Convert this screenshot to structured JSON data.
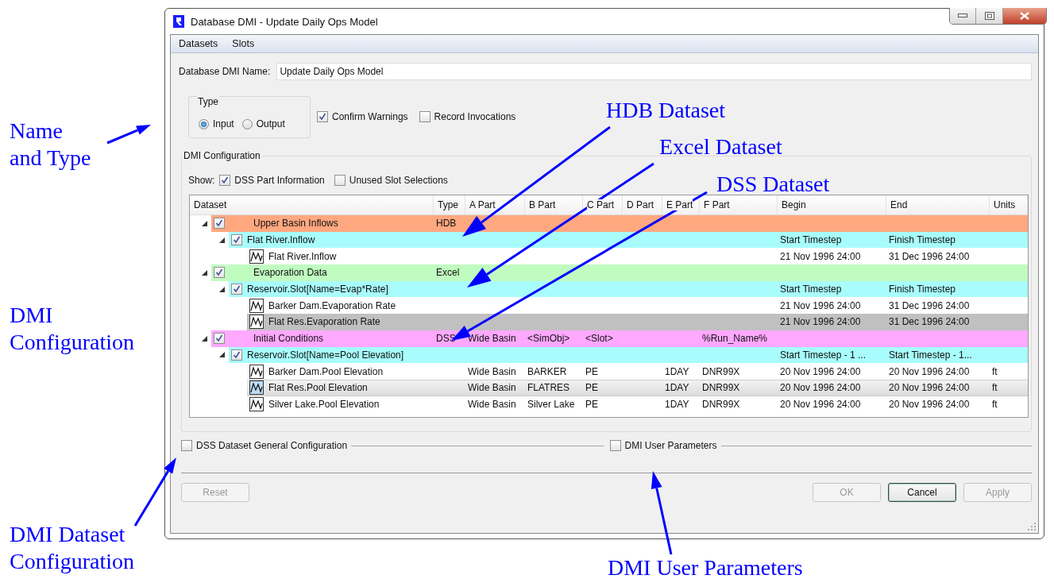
{
  "window": {
    "title": "Database DMI - Update Daily Ops Model"
  },
  "menu": [
    {
      "label": "Datasets"
    },
    {
      "label": "Slots"
    }
  ],
  "name_field": {
    "label": "Database DMI Name:",
    "value": "Update Daily Ops Model"
  },
  "type_group": {
    "title": "Type",
    "options": [
      {
        "label": "Input",
        "selected": true
      },
      {
        "label": "Output",
        "selected": false
      }
    ]
  },
  "options": [
    {
      "label": "Confirm Warnings",
      "checked": true
    },
    {
      "label": "Record Invocations",
      "checked": false
    }
  ],
  "dmi_configuration": {
    "title": "DMI Configuration",
    "show_label": "Show:",
    "show_options": [
      {
        "label": "DSS Part Information",
        "checked": true
      },
      {
        "label": "Unused Slot Selections",
        "checked": false
      }
    ],
    "columns": [
      "Dataset",
      "Type",
      "A Part",
      "B Part",
      "C Part",
      "D Part",
      "E Part",
      "F Part",
      "Begin",
      "End",
      "Units"
    ],
    "datasets": [
      {
        "kind": "dataset",
        "name": "Upper Basin Inflows",
        "color": "#ffa880",
        "expanded": true,
        "checked": true,
        "cells": {
          "type": "HDB"
        },
        "children": [
          {
            "kind": "slot",
            "name": "Flat River.Inflow",
            "color": "#a8fcfc",
            "expanded": true,
            "checked": true,
            "cells": {
              "begin": "Start Timestep",
              "end": "Finish Timestep"
            },
            "children": [
              {
                "kind": "series",
                "name": "Flat River.Inflow",
                "selected": false,
                "hovered": false,
                "cells": {
                  "begin": "21 Nov 1996 24:00",
                  "end": "31 Dec 1996 24:00"
                }
              }
            ]
          }
        ]
      },
      {
        "kind": "dataset",
        "name": "Evaporation Data",
        "color": "#c0fcc0",
        "expanded": true,
        "checked": true,
        "cells": {
          "type": "Excel"
        },
        "children": [
          {
            "kind": "slot",
            "name": "Reservoir.Slot[Name=Evap*Rate]",
            "color": "#a8fcfc",
            "expanded": true,
            "checked": true,
            "cells": {
              "begin": "Start Timestep",
              "end": "Finish Timestep"
            },
            "children": [
              {
                "kind": "series",
                "name": "Barker Dam.Evaporation Rate",
                "selected": false,
                "hovered": false,
                "cells": {
                  "begin": "21 Nov 1996 24:00",
                  "end": "31 Dec 1996 24:00"
                }
              },
              {
                "kind": "series",
                "name": "Flat Res.Evaporation Rate",
                "selected": true,
                "hovered": false,
                "cells": {
                  "begin": "21 Nov 1996 24:00",
                  "end": "31 Dec 1996 24:00"
                }
              }
            ]
          }
        ]
      },
      {
        "kind": "dataset",
        "name": "Initial Conditions",
        "color": "#ffa8ff",
        "expanded": true,
        "checked": true,
        "cells": {
          "type": "DSS",
          "a": "Wide Basin",
          "b": "<SimObj>",
          "c": "<Slot>",
          "f": "%Run_Name%"
        },
        "children": [
          {
            "kind": "slot",
            "name": "Reservoir.Slot[Name=Pool Elevation]",
            "color": "#a8fcfc",
            "expanded": true,
            "checked": true,
            "cells": {
              "begin": "Start Timestep - 1 ...",
              "end": "Start Timestep - 1..."
            },
            "children": [
              {
                "kind": "series",
                "name": "Barker Dam.Pool Elevation",
                "selected": false,
                "hovered": false,
                "cells": {
                  "a": "Wide Basin",
                  "b": "BARKER",
                  "c": "PE",
                  "e": "1DAY",
                  "f": "DNR99X",
                  "begin": "20 Nov 1996 24:00",
                  "end": "20 Nov 1996 24:00",
                  "units": "ft"
                }
              },
              {
                "kind": "series",
                "name": "Flat Res.Pool Elevation",
                "selected": false,
                "hovered": true,
                "cells": {
                  "a": "Wide Basin",
                  "b": "FLATRES",
                  "c": "PE",
                  "e": "1DAY",
                  "f": "DNR99X",
                  "begin": "20 Nov 1996 24:00",
                  "end": "20 Nov 1996 24:00",
                  "units": "ft"
                }
              },
              {
                "kind": "series",
                "name": "Silver Lake.Pool Elevation",
                "selected": false,
                "hovered": false,
                "cells": {
                  "a": "Wide Basin",
                  "b": "Silver Lake",
                  "c": "PE",
                  "e": "1DAY",
                  "f": "DNR99X",
                  "begin": "20 Nov 1996 24:00",
                  "end": "20 Nov 1996 24:00",
                  "units": "ft"
                }
              }
            ]
          }
        ]
      }
    ]
  },
  "sections": [
    {
      "label": "DSS Dataset General Configuration",
      "checked": false
    },
    {
      "label": "DMI User Parameters",
      "checked": false
    }
  ],
  "buttons": [
    {
      "label": "Reset",
      "disabled": true,
      "default": false
    },
    {
      "label": "OK",
      "disabled": true,
      "default": false
    },
    {
      "label": "Cancel",
      "disabled": false,
      "default": true
    },
    {
      "label": "Apply",
      "disabled": true,
      "default": false
    }
  ],
  "annotations": [
    {
      "lines": [
        "HDB Dataset"
      ]
    },
    {
      "lines": [
        "Name",
        "and Type"
      ]
    },
    {
      "lines": [
        "Excel Dataset"
      ]
    },
    {
      "lines": [
        "DSS Dataset"
      ]
    },
    {
      "lines": [
        "DMI",
        "Configuration"
      ]
    },
    {
      "lines": [
        "DMI Dataset",
        "Configuration"
      ]
    },
    {
      "lines": [
        "DMI User Parameters"
      ]
    }
  ]
}
